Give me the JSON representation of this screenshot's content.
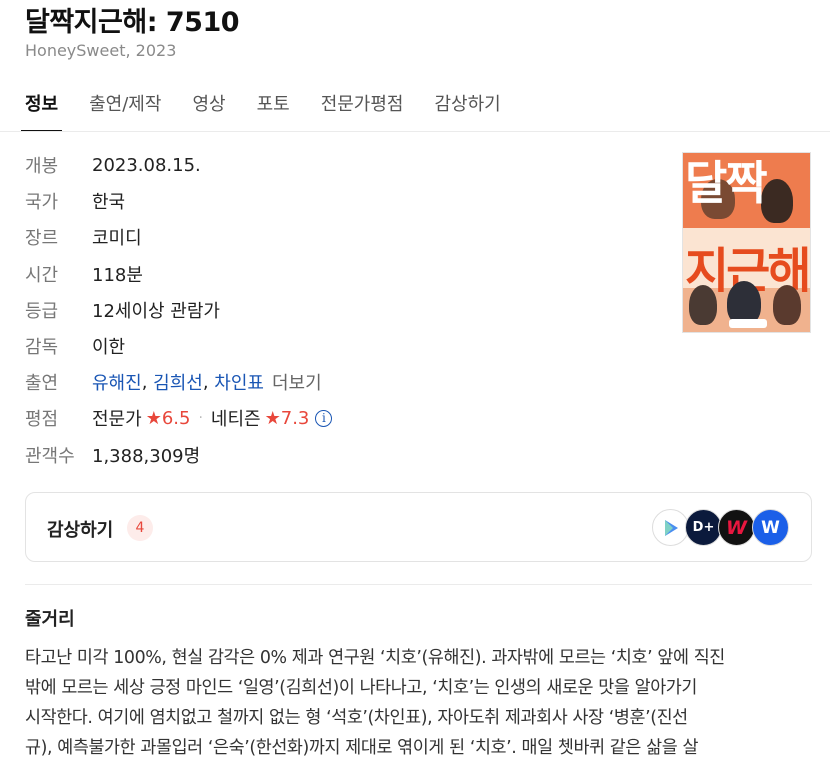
{
  "movie": {
    "title": "달짝지근해: 7510",
    "subtitle": "HoneySweet, 2023"
  },
  "tabs": [
    {
      "label": "정보",
      "active": true
    },
    {
      "label": "출연/제작",
      "active": false
    },
    {
      "label": "영상",
      "active": false
    },
    {
      "label": "포토",
      "active": false
    },
    {
      "label": "전문가평점",
      "active": false
    },
    {
      "label": "감상하기",
      "active": false
    }
  ],
  "info": {
    "release": {
      "label": "개봉",
      "value": "2023.08.15."
    },
    "country": {
      "label": "국가",
      "value": "한국"
    },
    "genre": {
      "label": "장르",
      "value": "코미디"
    },
    "runtime": {
      "label": "시간",
      "value": "118분"
    },
    "rating": {
      "label": "등급",
      "value": "12세이상 관람가"
    },
    "director": {
      "label": "감독",
      "value": "이한"
    },
    "cast": {
      "label": "출연",
      "names": [
        "유해진",
        "김희선",
        "차인표"
      ],
      "more": "더보기"
    },
    "score": {
      "label": "평점",
      "expert_label": "전문가",
      "expert_star": "★",
      "expert_value": "6.5",
      "netizen_label": "네티즌",
      "netizen_star": "★",
      "netizen_value": "7.3",
      "info_icon": "i"
    },
    "audience": {
      "label": "관객수",
      "value": "1,388,309명"
    }
  },
  "poster": {
    "text_top": "달짝",
    "text_bottom": "지근해"
  },
  "watch": {
    "title": "감상하기",
    "count": "4",
    "services": [
      {
        "icon": "play-store-icon",
        "glyph": "▶"
      },
      {
        "icon": "disney-plus-icon",
        "glyph": "D+"
      },
      {
        "icon": "watcha-icon",
        "glyph": "W"
      },
      {
        "icon": "wavve-icon",
        "glyph": "W"
      }
    ]
  },
  "synopsis": {
    "title": "줄거리",
    "lines": [
      "타고난 미각 100%, 현실 감각은 0% 제과 연구원 ‘치호’(유해진). 과자밖에 모르는 ‘치호’ 앞에 직진",
      "밖에 모르는 세상 긍정 마인드 ‘일영’(김희선)이 나타나고, ‘치호’는 인생의 새로운 맛을 알아가기",
      "시작한다. 여기에 염치없고 철까지 없는 형 ‘석호’(차인표), 자아도취 제과회사 사장 ‘병훈’(진선",
      "규), 예측불가한 과몰입러 ‘은숙’(한선화)까지 제대로 엮이게 된 ‘치호’. 매일 쳇바퀴 같은 삶을 살"
    ]
  },
  "colors": {
    "accent_star": "#e8473b",
    "link": "#1a56b4"
  }
}
